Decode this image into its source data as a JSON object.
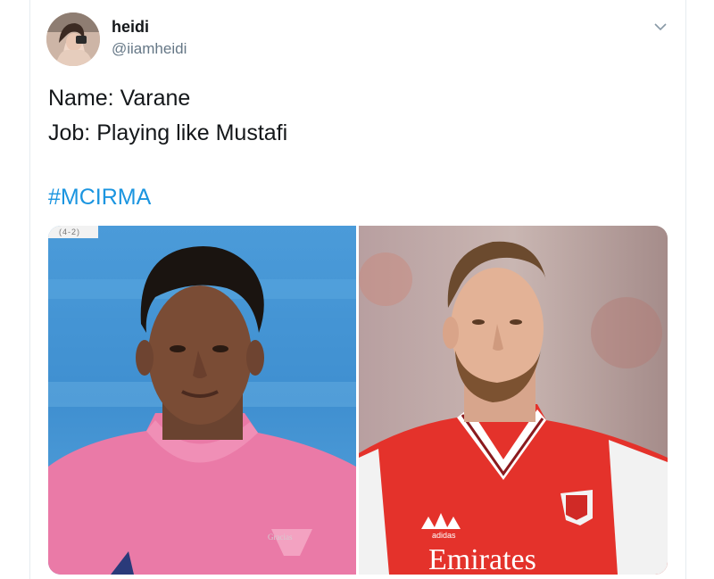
{
  "tweet": {
    "author": {
      "display_name": "heidi",
      "handle": "@iiamheidi"
    },
    "text_lines": [
      "Name: Varane",
      "Job: Playing like Mustafi"
    ],
    "hashtag": "#MCIRMA",
    "media": {
      "left_photo": {
        "score_badge": "(4-2)",
        "shirt_text": "Gracias"
      },
      "right_photo": {
        "sponsor": "Emirates",
        "brand": "adidas"
      }
    }
  },
  "icons": {
    "menu": "chevron-down-icon"
  },
  "colors": {
    "hashtag": "#1b95e0",
    "handle": "#657786",
    "text": "#14171a"
  }
}
